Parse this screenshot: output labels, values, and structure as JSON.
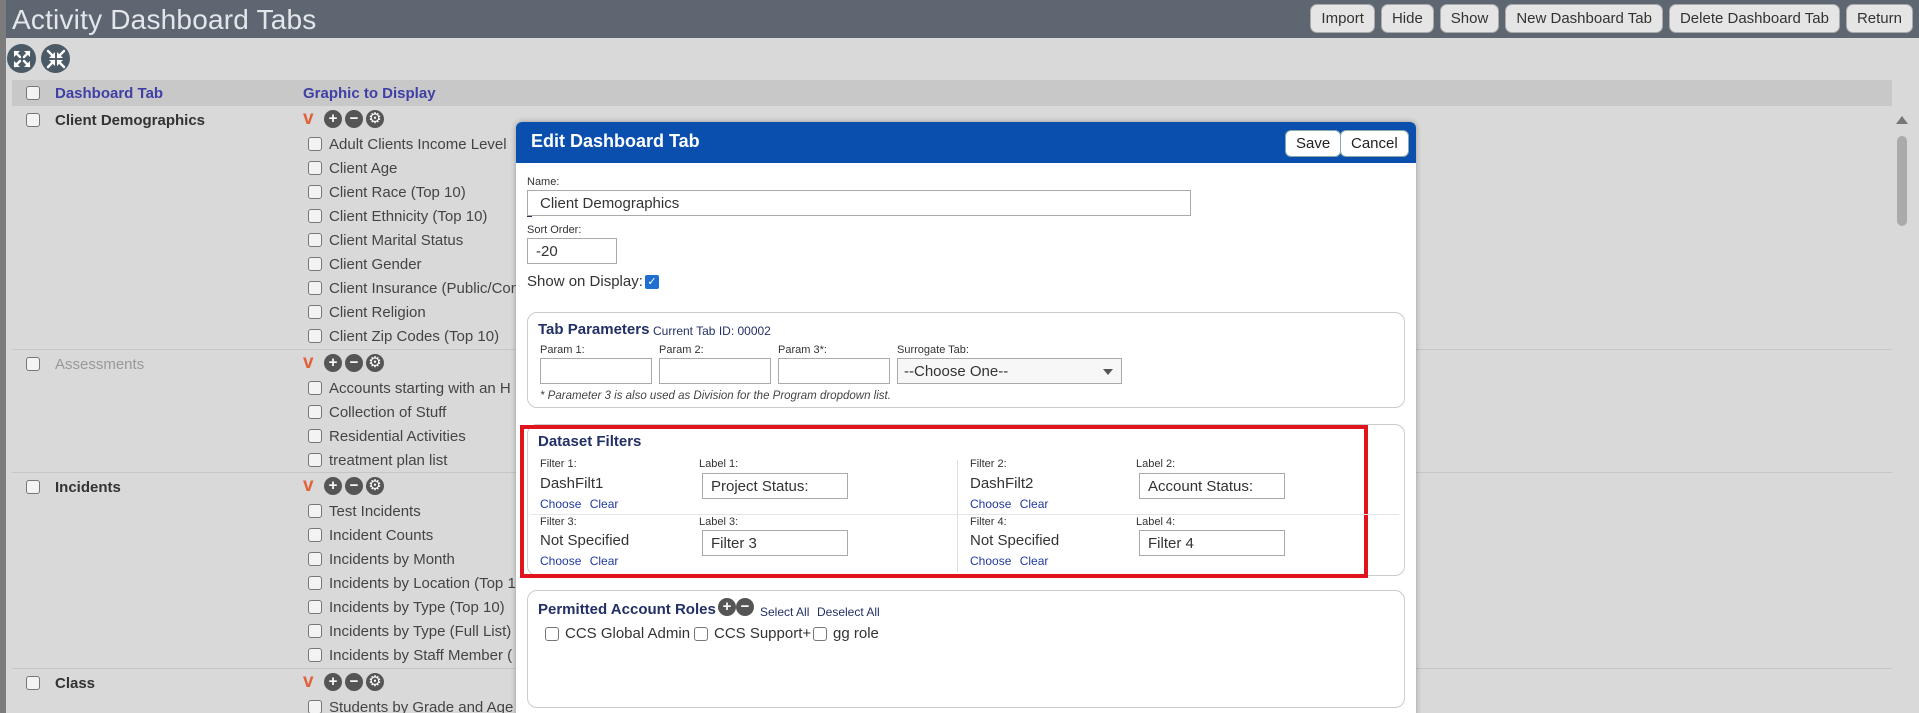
{
  "app": {
    "title": "Activity Dashboard Tabs"
  },
  "toolbar": [
    "Import",
    "Hide",
    "Show",
    "New Dashboard Tab",
    "Delete Dashboard Tab",
    "Return"
  ],
  "table": {
    "col_tab": "Dashboard Tab",
    "col_graphic": "Graphic to Display"
  },
  "groups": [
    {
      "name": "Client Demographics",
      "items": [
        "Adult Clients Income Level",
        "Client Age",
        "Client Race (Top 10)",
        "Client Ethnicity (Top 10)",
        "Client Marital Status",
        "Client Gender",
        "Client Insurance (Public/Con",
        "Client Religion",
        "Client Zip Codes (Top 10)"
      ]
    },
    {
      "name": "Assessments",
      "items": [
        "Accounts starting with an H",
        "Collection of Stuff",
        "Residential Activities",
        "treatment plan list"
      ]
    },
    {
      "name": "Incidents",
      "items": [
        "Test Incidents",
        "Incident Counts",
        "Incidents by Month",
        "Incidents by Location (Top 1",
        "Incidents by Type (Top 10)",
        "Incidents by Type (Full List)",
        "Incidents by Staff Member ("
      ]
    },
    {
      "name": "Class",
      "items": [
        "Students by Grade and Age"
      ]
    }
  ],
  "modal": {
    "title": "Edit Dashboard Tab",
    "save": "Save",
    "cancel": "Cancel",
    "name_label": "Name:",
    "name_value": "Client Demographics",
    "sort_label": "Sort Order:",
    "sort_value": "-20",
    "show_label": "Show on Display:",
    "show_checked": true,
    "params": {
      "title": "Tab Parameters",
      "tab_id": "Current Tab ID: 00002",
      "p1": "Param 1:",
      "p2": "Param 2:",
      "p3": "Param 3*:",
      "surrogate": "Surrogate Tab:",
      "surrogate_value": "--Choose One--",
      "note": "* Parameter 3 is also used as Division for the Program dropdown list."
    },
    "filters": {
      "title": "Dataset Filters",
      "f1_label": "Filter 1:",
      "f1_value": "DashFilt1",
      "l1_label": "Label 1:",
      "l1_value": "Project Status:",
      "f2_label": "Filter 2:",
      "f2_value": "DashFilt2",
      "l2_label": "Label 2:",
      "l2_value": "Account Status:",
      "f3_label": "Filter 3:",
      "f3_value": "Not Specified",
      "l3_label": "Label 3:",
      "l3_value": "Filter 3",
      "f4_label": "Filter 4:",
      "f4_value": "Not Specified",
      "l4_label": "Label 4:",
      "l4_value": "Filter 4",
      "choose": "Choose",
      "clear": "Clear"
    },
    "roles": {
      "title": "Permitted Account Roles",
      "select_all": "Select All",
      "deselect_all": "Deselect All",
      "items": [
        "CCS Global Admin",
        "CCS Support+",
        "gg role"
      ]
    }
  }
}
